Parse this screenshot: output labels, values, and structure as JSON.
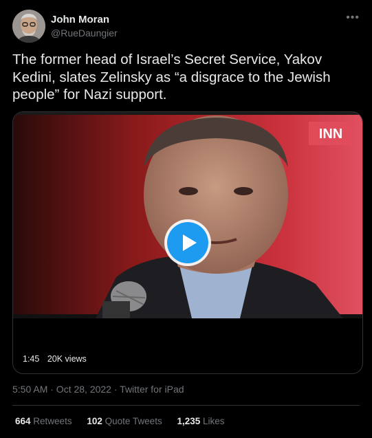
{
  "author": {
    "name": "John Moran",
    "handle": "@RueDaungier"
  },
  "more_icon": "more-horizontal-icon",
  "tweet_text": "The former head of Israel’s Secret Service, Yakov Kedini, slates Zelinsky as “a disgrace to the Jewish people” for Nazi support.",
  "video": {
    "watermark": "INN",
    "duration": "1:45",
    "views": "20K views",
    "play_icon": "play-icon"
  },
  "meta": {
    "time": "5:50 AM · Oct 28, 2022 · Twitter for iPad"
  },
  "stats": {
    "retweets_count": "664",
    "retweets_label": "Retweets",
    "quotes_count": "102",
    "quotes_label": "Quote Tweets",
    "likes_count": "1,235",
    "likes_label": "Likes"
  },
  "colors": {
    "background": "#000000",
    "text": "#e7e9ea",
    "secondary": "#71767b",
    "accent": "#1d9bf0",
    "border": "#2f3336"
  }
}
